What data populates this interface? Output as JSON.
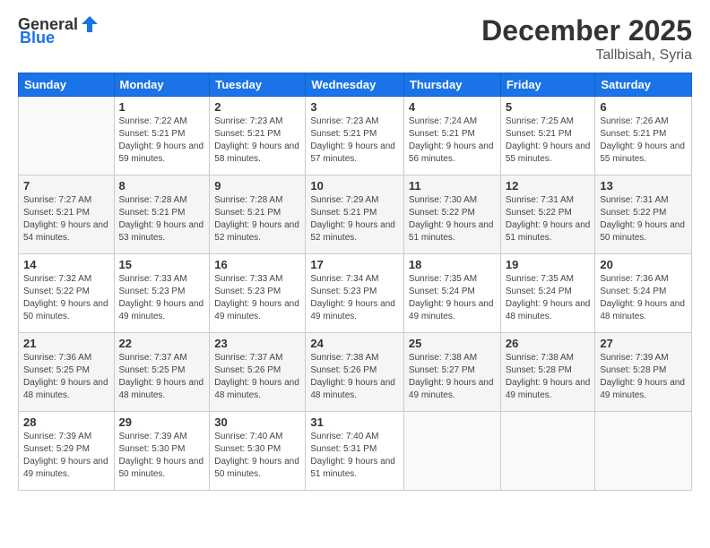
{
  "header": {
    "logo_general": "General",
    "logo_blue": "Blue",
    "month": "December 2025",
    "location": "Tallbisah, Syria"
  },
  "days_of_week": [
    "Sunday",
    "Monday",
    "Tuesday",
    "Wednesday",
    "Thursday",
    "Friday",
    "Saturday"
  ],
  "weeks": [
    [
      {
        "day": "",
        "sunrise": "",
        "sunset": "",
        "daylight": ""
      },
      {
        "day": "1",
        "sunrise": "Sunrise: 7:22 AM",
        "sunset": "Sunset: 5:21 PM",
        "daylight": "Daylight: 9 hours and 59 minutes."
      },
      {
        "day": "2",
        "sunrise": "Sunrise: 7:23 AM",
        "sunset": "Sunset: 5:21 PM",
        "daylight": "Daylight: 9 hours and 58 minutes."
      },
      {
        "day": "3",
        "sunrise": "Sunrise: 7:23 AM",
        "sunset": "Sunset: 5:21 PM",
        "daylight": "Daylight: 9 hours and 57 minutes."
      },
      {
        "day": "4",
        "sunrise": "Sunrise: 7:24 AM",
        "sunset": "Sunset: 5:21 PM",
        "daylight": "Daylight: 9 hours and 56 minutes."
      },
      {
        "day": "5",
        "sunrise": "Sunrise: 7:25 AM",
        "sunset": "Sunset: 5:21 PM",
        "daylight": "Daylight: 9 hours and 55 minutes."
      },
      {
        "day": "6",
        "sunrise": "Sunrise: 7:26 AM",
        "sunset": "Sunset: 5:21 PM",
        "daylight": "Daylight: 9 hours and 55 minutes."
      }
    ],
    [
      {
        "day": "7",
        "sunrise": "Sunrise: 7:27 AM",
        "sunset": "Sunset: 5:21 PM",
        "daylight": "Daylight: 9 hours and 54 minutes."
      },
      {
        "day": "8",
        "sunrise": "Sunrise: 7:28 AM",
        "sunset": "Sunset: 5:21 PM",
        "daylight": "Daylight: 9 hours and 53 minutes."
      },
      {
        "day": "9",
        "sunrise": "Sunrise: 7:28 AM",
        "sunset": "Sunset: 5:21 PM",
        "daylight": "Daylight: 9 hours and 52 minutes."
      },
      {
        "day": "10",
        "sunrise": "Sunrise: 7:29 AM",
        "sunset": "Sunset: 5:21 PM",
        "daylight": "Daylight: 9 hours and 52 minutes."
      },
      {
        "day": "11",
        "sunrise": "Sunrise: 7:30 AM",
        "sunset": "Sunset: 5:22 PM",
        "daylight": "Daylight: 9 hours and 51 minutes."
      },
      {
        "day": "12",
        "sunrise": "Sunrise: 7:31 AM",
        "sunset": "Sunset: 5:22 PM",
        "daylight": "Daylight: 9 hours and 51 minutes."
      },
      {
        "day": "13",
        "sunrise": "Sunrise: 7:31 AM",
        "sunset": "Sunset: 5:22 PM",
        "daylight": "Daylight: 9 hours and 50 minutes."
      }
    ],
    [
      {
        "day": "14",
        "sunrise": "Sunrise: 7:32 AM",
        "sunset": "Sunset: 5:22 PM",
        "daylight": "Daylight: 9 hours and 50 minutes."
      },
      {
        "day": "15",
        "sunrise": "Sunrise: 7:33 AM",
        "sunset": "Sunset: 5:23 PM",
        "daylight": "Daylight: 9 hours and 49 minutes."
      },
      {
        "day": "16",
        "sunrise": "Sunrise: 7:33 AM",
        "sunset": "Sunset: 5:23 PM",
        "daylight": "Daylight: 9 hours and 49 minutes."
      },
      {
        "day": "17",
        "sunrise": "Sunrise: 7:34 AM",
        "sunset": "Sunset: 5:23 PM",
        "daylight": "Daylight: 9 hours and 49 minutes."
      },
      {
        "day": "18",
        "sunrise": "Sunrise: 7:35 AM",
        "sunset": "Sunset: 5:24 PM",
        "daylight": "Daylight: 9 hours and 49 minutes."
      },
      {
        "day": "19",
        "sunrise": "Sunrise: 7:35 AM",
        "sunset": "Sunset: 5:24 PM",
        "daylight": "Daylight: 9 hours and 48 minutes."
      },
      {
        "day": "20",
        "sunrise": "Sunrise: 7:36 AM",
        "sunset": "Sunset: 5:24 PM",
        "daylight": "Daylight: 9 hours and 48 minutes."
      }
    ],
    [
      {
        "day": "21",
        "sunrise": "Sunrise: 7:36 AM",
        "sunset": "Sunset: 5:25 PM",
        "daylight": "Daylight: 9 hours and 48 minutes."
      },
      {
        "day": "22",
        "sunrise": "Sunrise: 7:37 AM",
        "sunset": "Sunset: 5:25 PM",
        "daylight": "Daylight: 9 hours and 48 minutes."
      },
      {
        "day": "23",
        "sunrise": "Sunrise: 7:37 AM",
        "sunset": "Sunset: 5:26 PM",
        "daylight": "Daylight: 9 hours and 48 minutes."
      },
      {
        "day": "24",
        "sunrise": "Sunrise: 7:38 AM",
        "sunset": "Sunset: 5:26 PM",
        "daylight": "Daylight: 9 hours and 48 minutes."
      },
      {
        "day": "25",
        "sunrise": "Sunrise: 7:38 AM",
        "sunset": "Sunset: 5:27 PM",
        "daylight": "Daylight: 9 hours and 49 minutes."
      },
      {
        "day": "26",
        "sunrise": "Sunrise: 7:38 AM",
        "sunset": "Sunset: 5:28 PM",
        "daylight": "Daylight: 9 hours and 49 minutes."
      },
      {
        "day": "27",
        "sunrise": "Sunrise: 7:39 AM",
        "sunset": "Sunset: 5:28 PM",
        "daylight": "Daylight: 9 hours and 49 minutes."
      }
    ],
    [
      {
        "day": "28",
        "sunrise": "Sunrise: 7:39 AM",
        "sunset": "Sunset: 5:29 PM",
        "daylight": "Daylight: 9 hours and 49 minutes."
      },
      {
        "day": "29",
        "sunrise": "Sunrise: 7:39 AM",
        "sunset": "Sunset: 5:30 PM",
        "daylight": "Daylight: 9 hours and 50 minutes."
      },
      {
        "day": "30",
        "sunrise": "Sunrise: 7:40 AM",
        "sunset": "Sunset: 5:30 PM",
        "daylight": "Daylight: 9 hours and 50 minutes."
      },
      {
        "day": "31",
        "sunrise": "Sunrise: 7:40 AM",
        "sunset": "Sunset: 5:31 PM",
        "daylight": "Daylight: 9 hours and 51 minutes."
      },
      {
        "day": "",
        "sunrise": "",
        "sunset": "",
        "daylight": ""
      },
      {
        "day": "",
        "sunrise": "",
        "sunset": "",
        "daylight": ""
      },
      {
        "day": "",
        "sunrise": "",
        "sunset": "",
        "daylight": ""
      }
    ]
  ]
}
